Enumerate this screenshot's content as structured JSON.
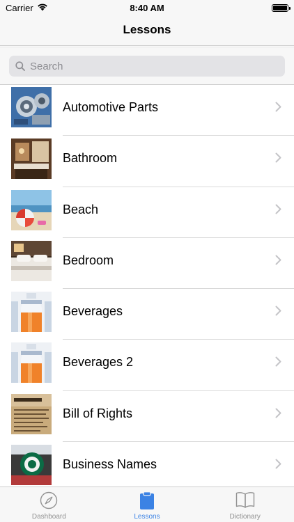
{
  "status_bar": {
    "carrier": "Carrier",
    "time": "8:40 AM"
  },
  "nav": {
    "title": "Lessons"
  },
  "search": {
    "placeholder": "Search",
    "value": ""
  },
  "lessons": [
    {
      "label": "Automotive Parts",
      "icon": "automotive-parts-thumbnail"
    },
    {
      "label": "Bathroom",
      "icon": "bathroom-thumbnail"
    },
    {
      "label": "Beach",
      "icon": "beach-thumbnail"
    },
    {
      "label": "Bedroom",
      "icon": "bedroom-thumbnail"
    },
    {
      "label": "Beverages",
      "icon": "beverages-thumbnail"
    },
    {
      "label": "Beverages 2",
      "icon": "beverages-2-thumbnail"
    },
    {
      "label": "Bill of Rights",
      "icon": "bill-of-rights-thumbnail"
    },
    {
      "label": "Business Names",
      "icon": "business-names-thumbnail"
    }
  ],
  "tabs": [
    {
      "label": "Dashboard",
      "icon": "compass-icon",
      "active": false
    },
    {
      "label": "Lessons",
      "icon": "clipboard-icon",
      "active": true
    },
    {
      "label": "Dictionary",
      "icon": "book-icon",
      "active": false
    }
  ],
  "colors": {
    "accent": "#3b82e4",
    "inactive": "#929292",
    "bar_background": "#f7f7f7"
  }
}
